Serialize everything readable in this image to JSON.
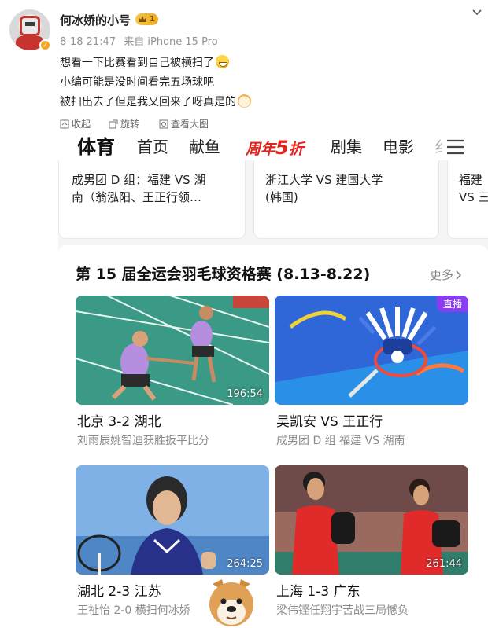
{
  "post": {
    "username": "何冰娇的小号",
    "vip_level": "1",
    "time": "8-18 21:47",
    "source": "来自 iPhone 15 Pro",
    "lines": [
      "想看一下比赛看到自己被横扫了",
      "小编可能是没时间看完五场球吧",
      "被扫出去了但是我又回来了呀真是的"
    ],
    "icons": {
      "avatar": "robot-avatar",
      "verified": "verified-badge",
      "more": "chevron-down-icon"
    }
  },
  "image_toolbar": {
    "collect": "收起",
    "rotate": "旋转",
    "view_large": "查看大图"
  },
  "screenshot": {
    "nav": {
      "items": [
        "体育",
        "首页",
        "献鱼"
      ],
      "promo": {
        "text": "周年",
        "number": "5",
        "suffix": "折"
      },
      "items_after": [
        "剧集",
        "电影",
        "纟"
      ],
      "accent": "#e2231a"
    },
    "match_cards": [
      {
        "line1": "成男团 D 组：福建 VS 湖",
        "line2": "南（翁泓阳、王正行领…"
      },
      {
        "line1": "浙江大学 VS 建国大学",
        "line2": "(韩国)"
      },
      {
        "line1": "福建",
        "line2": "VS 三"
      }
    ],
    "section": {
      "title": "第 15 届全运会羽毛球资格赛 (8.13-8.22)",
      "more": "更多"
    },
    "videos": [
      {
        "title": "北京 3-2 湖北",
        "subtitle": "刘雨辰姚智迪获胜扳平比分",
        "duration": "196:54",
        "live": ""
      },
      {
        "title": "吴凯安 VS 王正行",
        "subtitle": "成男团 D 组 福建 VS 湖南",
        "duration": "",
        "live": "直播"
      },
      {
        "title": "湖北 2-3 江苏",
        "subtitle": "王祉怡 2-0 横扫何冰娇",
        "duration": "264:25",
        "live": ""
      },
      {
        "title": "上海 1-3 广东",
        "subtitle": "梁伟铿任翔宇苦战三局憾负",
        "duration": "261:44",
        "live": ""
      }
    ]
  }
}
